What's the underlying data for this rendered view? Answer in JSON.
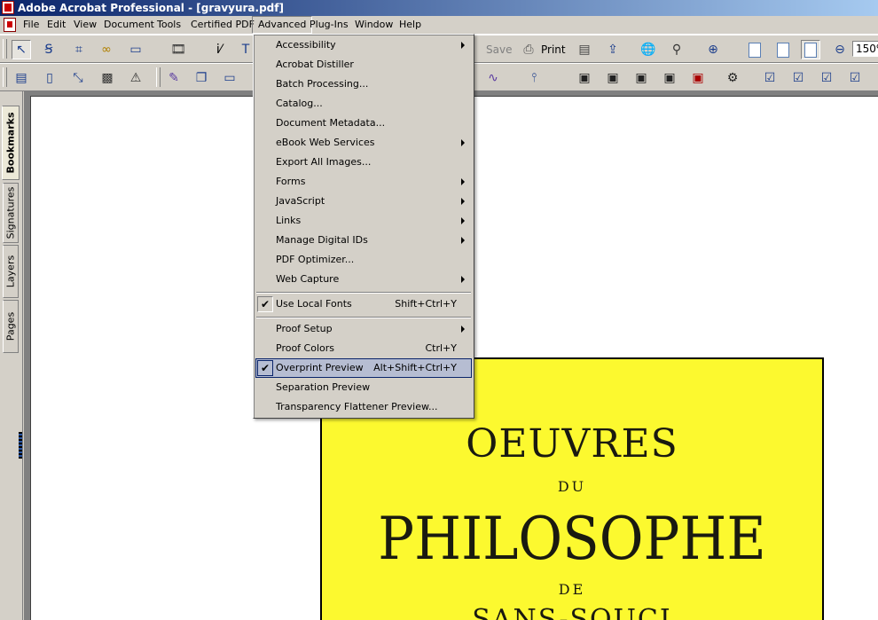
{
  "window": {
    "title": "Adobe Acrobat Professional - [gravyura.pdf]"
  },
  "menubar": {
    "items": [
      "File",
      "Edit",
      "View",
      "Document",
      "Tools",
      "Certified PDF",
      "Advanced",
      "Plug-Ins",
      "Window",
      "Help"
    ],
    "active": "Advanced"
  },
  "toolbar": {
    "save_label": "Save",
    "print_label": "Print",
    "zoom_value": "150%"
  },
  "advanced_menu": {
    "items": [
      {
        "label": "Accessibility",
        "shortcut": "",
        "submenu": true,
        "checked": false
      },
      {
        "label": "Acrobat Distiller",
        "shortcut": "",
        "submenu": false,
        "checked": false
      },
      {
        "label": "Batch Processing...",
        "shortcut": "",
        "submenu": false,
        "checked": false
      },
      {
        "label": "Catalog...",
        "shortcut": "",
        "submenu": false,
        "checked": false
      },
      {
        "label": "Document Metadata...",
        "shortcut": "",
        "submenu": false,
        "checked": false
      },
      {
        "label": "eBook Web Services",
        "shortcut": "",
        "submenu": true,
        "checked": false
      },
      {
        "label": "Export All Images...",
        "shortcut": "",
        "submenu": false,
        "checked": false
      },
      {
        "label": "Forms",
        "shortcut": "",
        "submenu": true,
        "checked": false
      },
      {
        "label": "JavaScript",
        "shortcut": "",
        "submenu": true,
        "checked": false
      },
      {
        "label": "Links",
        "shortcut": "",
        "submenu": true,
        "checked": false
      },
      {
        "label": "Manage Digital IDs",
        "shortcut": "",
        "submenu": true,
        "checked": false
      },
      {
        "label": "PDF Optimizer...",
        "shortcut": "",
        "submenu": false,
        "checked": false
      },
      {
        "label": "Web Capture",
        "shortcut": "",
        "submenu": true,
        "checked": false
      },
      {
        "label": "Use Local Fonts",
        "shortcut": "Shift+Ctrl+Y",
        "submenu": false,
        "checked": true
      },
      {
        "label": "Proof Setup",
        "shortcut": "",
        "submenu": true,
        "checked": false
      },
      {
        "label": "Proof Colors",
        "shortcut": "Ctrl+Y",
        "submenu": false,
        "checked": false
      },
      {
        "label": "Overprint Preview",
        "shortcut": "Alt+Shift+Ctrl+Y",
        "submenu": false,
        "checked": true,
        "highlighted": true
      },
      {
        "label": "Separation Preview",
        "shortcut": "",
        "submenu": false,
        "checked": false
      },
      {
        "label": "Transparency Flattener Preview...",
        "shortcut": "",
        "submenu": false,
        "checked": false
      }
    ]
  },
  "nav_tabs": [
    {
      "label": "Bookmarks",
      "active": true
    },
    {
      "label": "Signatures",
      "active": false
    },
    {
      "label": "Layers",
      "active": false
    },
    {
      "label": "Pages",
      "active": false
    }
  ],
  "document": {
    "lines": [
      "OEUVRES",
      "DU",
      "PHILOSOPHE",
      "DE",
      "SANS-SOUCI"
    ],
    "cover_color": "#fcf92f"
  },
  "colors": {
    "highlight": "#b6bdd2",
    "title_bar": "#0a246a",
    "chrome": "#d4d0c8"
  }
}
